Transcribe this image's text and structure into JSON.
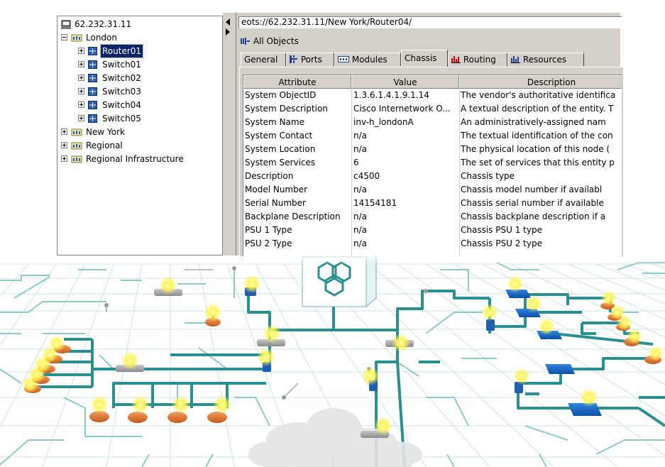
{
  "tree": {
    "root_label": "62.232.31.11",
    "london_label": "London",
    "london_children": [
      "Router01",
      "Switch01",
      "Switch02",
      "Switch03",
      "Switch04",
      "Switch05"
    ],
    "selected_child": "Router01",
    "other_groups": [
      "New York",
      "Regional",
      "Regional Infrastructure"
    ]
  },
  "detail": {
    "path": "eots://62.232.31.11/New York/Router04/",
    "all_objects_label": "All Objects",
    "tabs": [
      {
        "label": "General",
        "icon": "none"
      },
      {
        "label": "Ports",
        "icon": "ports-icon"
      },
      {
        "label": "Modules",
        "icon": "modules-icon"
      },
      {
        "label": "Chassis",
        "icon": "none"
      },
      {
        "label": "Routing",
        "icon": "chart-icon"
      },
      {
        "label": "Resources",
        "icon": "chart-icon"
      }
    ],
    "active_tab": "Chassis",
    "table": {
      "columns": [
        "Attribute",
        "Value",
        "Description"
      ],
      "rows": [
        [
          "System ObjectID",
          "1.3.6.1.4.1.9.1.14",
          "The vendor's authoritative identifica"
        ],
        [
          "System Description",
          "Cisco Internetwork O...",
          "A textual description of the entity.  T"
        ],
        [
          "System Name",
          "inv-h_londonA",
          "An administratively-assigned nam"
        ],
        [
          "System Contact",
          "n/a",
          "The textual identification of the con"
        ],
        [
          "System Location",
          "n/a",
          "The physical location of this node ("
        ],
        [
          "System Services",
          "6",
          "The set of services that this entity p"
        ],
        [
          "Description",
          "c4500",
          "Chassis type"
        ],
        [
          "Model Number",
          "n/a",
          "Chassis model number if availabl"
        ],
        [
          "Serial Number",
          "14154181",
          "Chassis serial number if available"
        ],
        [
          "Backplane Description",
          "n/a",
          "Chassis backplane description if a"
        ],
        [
          "PSU 1 Type",
          "n/a",
          "Chassis PSU 1 type"
        ],
        [
          "PSU 2 Type",
          "n/a",
          "Chassis PSU 2 type"
        ]
      ]
    }
  },
  "colors": {
    "window_bg": "#d4d0c8",
    "selection": "#0a246a",
    "network_line": "#2a8f8f",
    "grid_line": "#cfe6e6",
    "router_blue": "#1565c0",
    "node_orange": "#e07b30",
    "glow": "#fff34d"
  }
}
